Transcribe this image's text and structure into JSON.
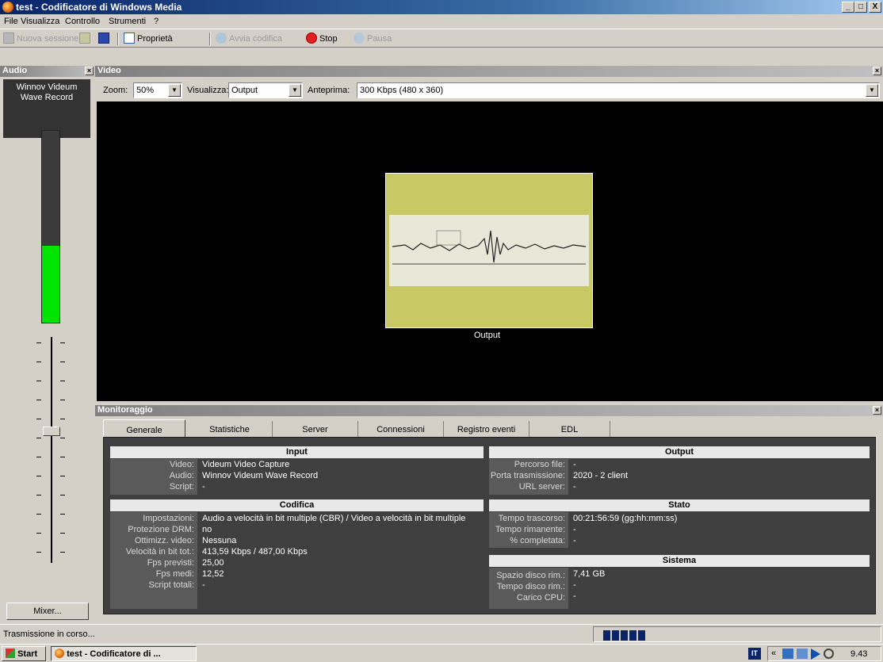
{
  "window": {
    "title": "test - Codificatore di Windows Media",
    "min": "_",
    "max": "□",
    "close": "X"
  },
  "menu": [
    "File",
    "Visualizza",
    "Controllo",
    "Strumenti",
    "?"
  ],
  "toolbar": {
    "new_session": "Nuova sessione",
    "properties": "Proprietà",
    "start_encoding": "Avvia codifica",
    "stop": "Stop",
    "pause": "Pausa"
  },
  "audio_panel": {
    "title": "Audio",
    "source_line1": "Winnov Videum",
    "source_line2": "Wave Record",
    "level": 0.4,
    "mixer": "Mixer..."
  },
  "video_panel": {
    "title": "Video",
    "zoom_label": "Zoom:",
    "zoom_value": "50%",
    "view_label": "Visualizza:",
    "view_value": "Output",
    "preview_label": "Anteprima:",
    "preview_value": "300 Kbps (480 x 360)",
    "output_caption": "Output"
  },
  "monitor": {
    "title": "Monitoraggio",
    "tabs": [
      "Generale",
      "Statistiche",
      "Server",
      "Connessioni",
      "Registro eventi",
      "EDL"
    ],
    "input": {
      "header": "Input",
      "video_k": "Video:",
      "video_v": "Videum Video Capture",
      "audio_k": "Audio:",
      "audio_v": "Winnov Videum Wave Record",
      "script_k": "Script:",
      "script_v": "-"
    },
    "codifica": {
      "header": "Codifica",
      "imp_k": "Impostazioni:",
      "imp_v": "Audio a velocità in bit multiple (CBR) / Video a velocità in bit multiple",
      "drm_k": "Protezione DRM:",
      "drm_v": "no",
      "ott_k": "Ottimizz. video:",
      "ott_v": "Nessuna",
      "vel_k": "Velocità in bit tot.:",
      "vel_v": "413,59 Kbps / 487,00 Kbps",
      "fpsp_k": "Fps previsti:",
      "fpsp_v": "25,00",
      "fpsm_k": "Fps medi:",
      "fpsm_v": "12,52",
      "scr_k": "Script totali:",
      "scr_v": "-"
    },
    "output": {
      "header": "Output",
      "perc_k": "Percorso file:",
      "perc_v": "-",
      "porta_k": "Porta trasmissione:",
      "porta_v": "2020 - 2 client",
      "url_k": "URL server:",
      "url_v": "-"
    },
    "stato": {
      "header": "Stato",
      "tt_k": "Tempo trascorso:",
      "tt_v": "00:21:56:59  (gg:hh:mm:ss)",
      "tr_k": "Tempo rimanente:",
      "tr_v": "-",
      "pc_k": "% completata:",
      "pc_v": "-"
    },
    "sistema": {
      "header": "Sistema",
      "sd_k": "Spazio disco rim.:",
      "sd_v": "7,41 GB",
      "td_k": "Tempo disco rim.:",
      "td_v": "-",
      "cpu_k": "Carico CPU:",
      "cpu_v": "-"
    }
  },
  "statusbar": {
    "text": "Trasmissione in corso..."
  },
  "taskbar": {
    "start": "Start",
    "task": "test - Codificatore di ...",
    "lang": "IT",
    "clock": "9.43",
    "chevron": "«"
  },
  "colors": {
    "titlebar": "#0a246a",
    "meter_fill": "#00e400",
    "video_bg": "#000000",
    "monitor_bg": "#3f3f3f"
  }
}
